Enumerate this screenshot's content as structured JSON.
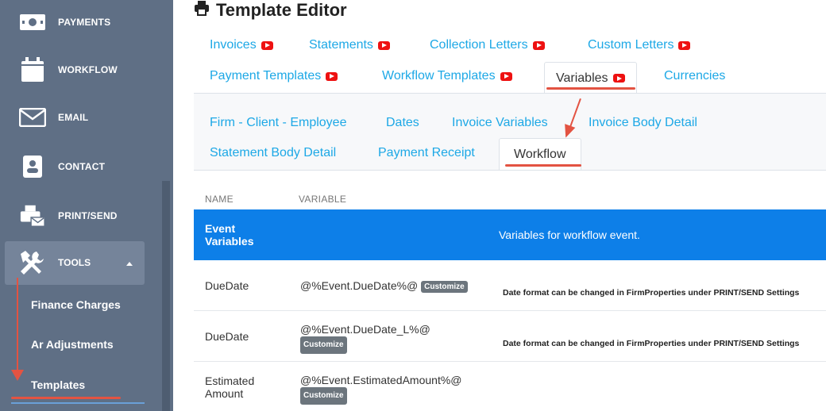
{
  "sidebar": {
    "items": [
      {
        "label": "PAYMENTS",
        "icon": "money-icon"
      },
      {
        "label": "WORKFLOW",
        "icon": "calendar-icon"
      },
      {
        "label": "EMAIL",
        "icon": "envelope-icon"
      },
      {
        "label": "CONTACT",
        "icon": "contact-card-icon"
      },
      {
        "label": "PRINT/SEND",
        "icon": "print-send-icon"
      }
    ],
    "tools": {
      "label": "TOOLS",
      "icon": "tools-icon"
    },
    "subitems": [
      "Finance Charges",
      "Ar Adjustments",
      "Templates"
    ]
  },
  "page": {
    "title": "Template Editor",
    "title_icon": "printer-icon"
  },
  "tabs": {
    "row1": [
      "Invoices",
      "Statements",
      "Collection Letters",
      "Custom Letters"
    ],
    "row2": [
      "Payment Templates",
      "Workflow Templates",
      "Variables",
      "Currencies"
    ],
    "active": "Variables"
  },
  "subtabs": {
    "row1": [
      "Firm - Client - Employee",
      "Dates",
      "Invoice Variables",
      "Invoice Body Detail"
    ],
    "row2": [
      "Statement Body Detail",
      "Payment Receipt",
      "Workflow"
    ],
    "active": "Workflow"
  },
  "table": {
    "headers": [
      "NAME",
      "VARIABLE"
    ],
    "highlight": {
      "name": "Event Variables",
      "desc": "Variables for workflow event."
    },
    "rows": [
      {
        "name": "DueDate",
        "var": "@%Event.DueDate%@",
        "badge": "Customize",
        "note": "Date format can be changed in FirmProperties under PRINT/SEND Settings"
      },
      {
        "name": "DueDate",
        "var": "@%Event.DueDate_L%@",
        "badge": "Customize",
        "note": "Date format can be changed in FirmProperties under PRINT/SEND Settings"
      },
      {
        "name": "Estimated Amount",
        "var": "@%Event.EstimatedAmount%@",
        "badge": "Customize",
        "note": ""
      }
    ]
  },
  "colors": {
    "accent": "#1da8e6",
    "highlight": "#0d7fe8",
    "sidebar": "#5f6f85",
    "annotation": "#e35342",
    "youtube": "#ee1111"
  }
}
